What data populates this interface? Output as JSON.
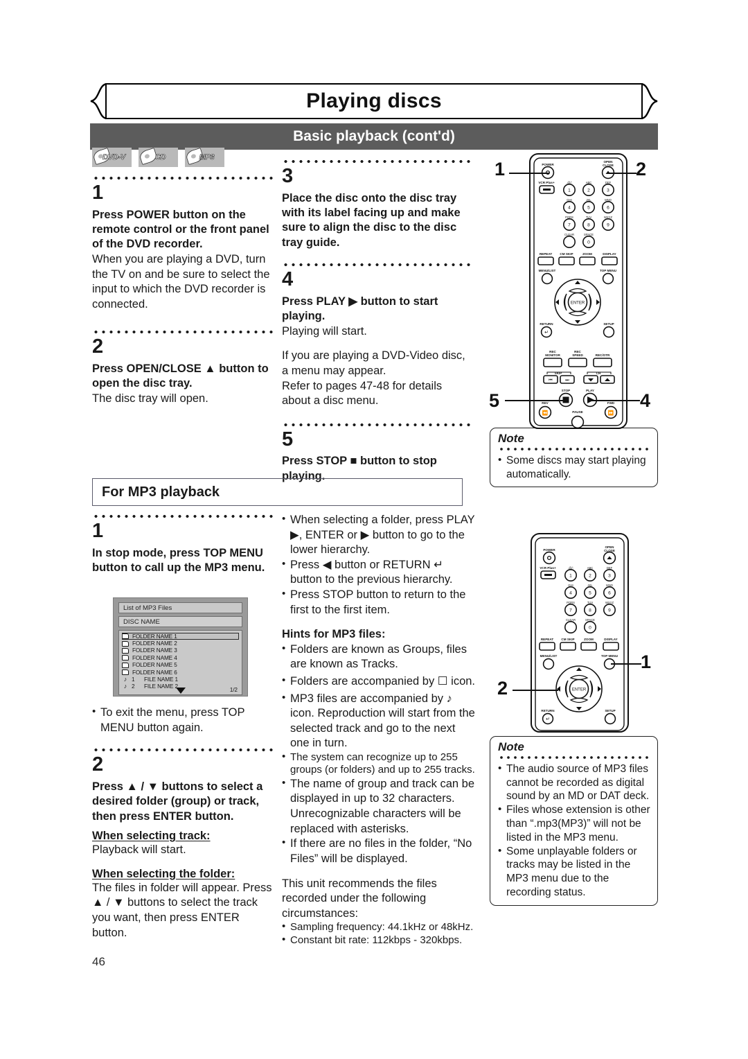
{
  "page": {
    "chapter_title": "Playing discs",
    "section_title": "Basic playback (cont'd)",
    "page_number": "46"
  },
  "disc_badges": [
    {
      "label": "DVD-V",
      "name": "badge-dvd-v"
    },
    {
      "label": "CD",
      "name": "badge-cd"
    },
    {
      "label": "MP3",
      "name": "badge-mp3"
    }
  ],
  "steps_basic": [
    {
      "number": "1",
      "bold": "Press POWER button on the remote control or the front panel of the DVD recorder.",
      "body": "When you are playing a DVD, turn the TV on and be sure to select the input to which the DVD recorder is connected."
    },
    {
      "number": "2",
      "bold": "Press OPEN/CLOSE ▲ button to open the disc tray.",
      "body": "The disc tray will open."
    },
    {
      "number": "3",
      "bold": "Place the disc onto the disc tray with its label facing up and make sure to align the disc to the disc tray guide.",
      "body": ""
    },
    {
      "number": "4",
      "bold": "Press PLAY ▶ button to start playing.",
      "body": "Playing will start.",
      "body2": "If you are playing a DVD-Video disc, a menu may appear.\nRefer to pages 47-48 for details about a disc menu."
    },
    {
      "number": "5",
      "bold": "Press STOP ■ button to stop playing.",
      "body": ""
    }
  ],
  "mp3_section": {
    "header": "For MP3 playback",
    "step1": {
      "number": "1",
      "bold": "In stop mode, press TOP MENU button to call up the MP3 menu.",
      "bullet": "To exit the menu, press TOP MENU button again."
    },
    "step2": {
      "number": "2",
      "bold": "Press ▲ / ▼ buttons to select a desired folder (group) or track, then press ENTER button.",
      "sub1_title": "When selecting track:",
      "sub1_body": "Playback will start.",
      "sub2_title": "When selecting the folder:",
      "sub2_body": "The files in folder will appear. Press ▲ / ▼ buttons to select the track you want, then press ENTER button."
    }
  },
  "osd": {
    "title": "List of MP3 Files",
    "disc_name": "DISC NAME",
    "folders": [
      "FOLDER NAME 1",
      "FOLDER NAME 2",
      "FOLDER NAME 3",
      "FOLDER NAME 4",
      "FOLDER NAME 5",
      "FOLDER NAME 6"
    ],
    "files": [
      {
        "num": "1",
        "name": "FILE NAME 1"
      },
      {
        "num": "2",
        "name": "FILE NAME 2"
      }
    ],
    "pager": "1/2"
  },
  "mp3_notes_bullets": [
    "When selecting a folder, press PLAY ▶, ENTER or ▶ button to go to the lower hierarchy.",
    "Press ◀ button or RETURN ↵ button to the previous hierarchy.",
    "Press STOP button to return to the first to the first item."
  ],
  "hints": {
    "title": "Hints for MP3 files:",
    "bullets": [
      "Folders are known as Groups, files are known as Tracks.",
      "Folders are accompanied by ☐ icon.",
      "MP3 files are accompanied by ♪ icon. Reproduction will start from the selected track and go to the next one in turn.",
      "The system can recognize up to 255 groups (or folders) and up to 255 tracks.",
      "The name of group and track can be displayed in up to 32 characters. Unrecognizable characters will be replaced with asterisks.",
      "If there are no files in the folder, “No Files” will be displayed."
    ],
    "closing_intro": "This unit recommends the files recorded under the following circumstances:",
    "closing_bullets": [
      "Sampling frequency: 44.1kHz or 48kHz.",
      "Constant bit rate: 112kbps - 320kbps."
    ]
  },
  "note1": {
    "title": "Note",
    "bullets": [
      "Some discs may start playing automatically."
    ]
  },
  "note2": {
    "title": "Note",
    "bullets": [
      "The audio source of MP3 files cannot be recorded as digital sound by an MD or DAT deck.",
      "Files whose extension is other than “.mp3(MP3)” will not be listed in the MP3 menu.",
      "Some unplayable folders or tracks may be listed in the MP3 menu due to the recording status."
    ]
  },
  "remote": {
    "labels": {
      "power": "POWER",
      "open_close_1": "OPEN",
      "open_close_2": "CLOSE",
      "vcr_plus": "VCR Plus+",
      "clear": "CLEAR",
      "space": "SPACE",
      "repeat": "REPEAT",
      "cm_skip": "CM SKIP",
      "zoom": "ZOOM",
      "display": "DISPLAY",
      "menu_list": "MENU/LIST",
      "top_menu": "TOP MENU",
      "enter": "ENTER",
      "return": "RETURN",
      "setup": "SETUP",
      "rec_monitor_1": "REC",
      "rec_monitor_2": "MONITOR",
      "rec_speed_1": "REC",
      "rec_speed_2": "SPEED",
      "rec_otr": "REC/OTR",
      "skip": "SKIP",
      "ch": "CH",
      "stop": "STOP",
      "play": "PLAY",
      "rev": "REV",
      "fwd": "FWD",
      "pause": "PAUSE"
    },
    "keypad": [
      {
        "letters": ".@/:",
        "digit": "1"
      },
      {
        "letters": "ABC",
        "digit": "2"
      },
      {
        "letters": "DEF",
        "digit": "3"
      },
      {
        "letters": "GHI",
        "digit": "4"
      },
      {
        "letters": "JKL",
        "digit": "5"
      },
      {
        "letters": "MNO",
        "digit": "6"
      },
      {
        "letters": "PQRS",
        "digit": "7"
      },
      {
        "letters": "TUV",
        "digit": "8"
      },
      {
        "letters": "WXYZ",
        "digit": "9"
      },
      {
        "letters": "SPACE",
        "digit": "0"
      }
    ]
  },
  "callouts": {
    "r1_power": "1",
    "r1_open": "2",
    "r1_stop": "5",
    "r1_play": "4",
    "r2_top_menu": "1",
    "r2_left": "2"
  }
}
